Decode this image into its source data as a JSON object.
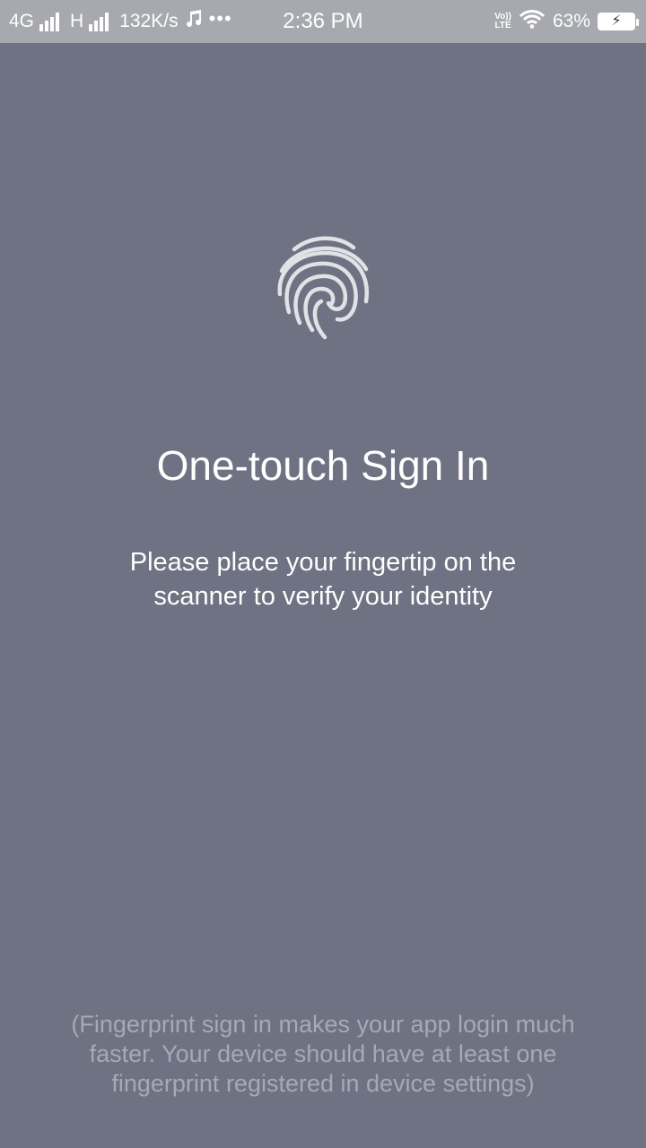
{
  "status_bar": {
    "network1": "4G",
    "network2": "H",
    "speed": "132K/s",
    "music_icon": "music-note-icon",
    "more": "•••",
    "time": "2:36 PM",
    "volte_top": "Vo))",
    "volte_bottom": "LTE",
    "battery": "63%",
    "battery_bolt": "⚡"
  },
  "main": {
    "icon": "fingerprint-icon",
    "title": "One-touch Sign In",
    "subtitle": "Please place your fingertip on the scanner to verify your identity",
    "note": "(Fingerprint sign in makes your app login much faster. Your device should have at least one fingerprint registered in device settings)"
  },
  "colors": {
    "background": "#6f7282",
    "status_bar": "#a7a9af",
    "note_text": "#a6a9b7"
  }
}
